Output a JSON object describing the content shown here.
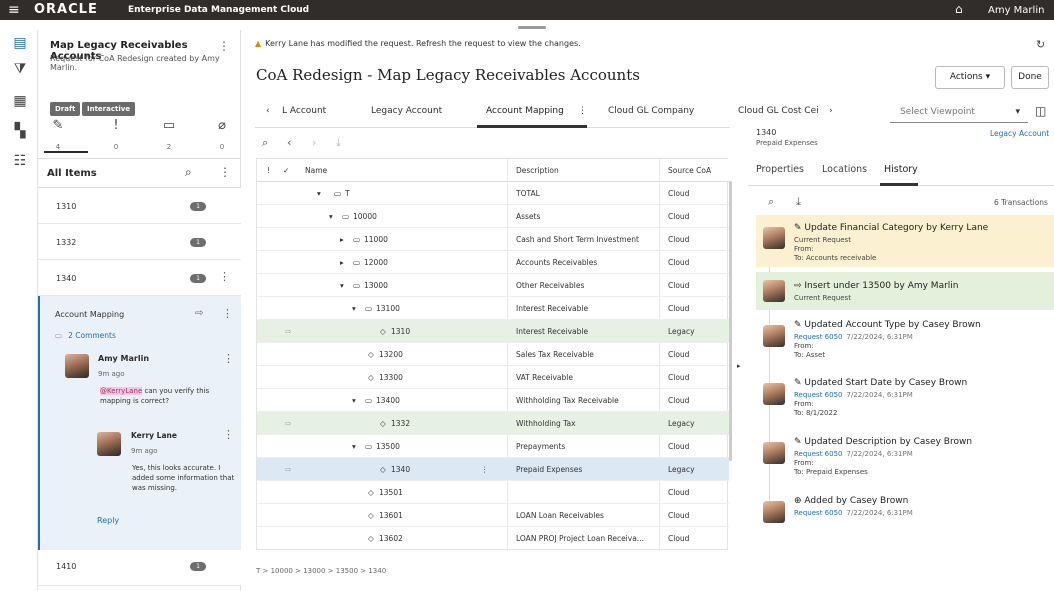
{
  "topbar": {
    "logo": "ORACLE",
    "app_name": "Enterprise Data Management Cloud",
    "user": "Amy Marlin"
  },
  "left_panel": {
    "title": "Map Legacy Receivables Accounts",
    "subtitle": "Request for CoA Redesign created by Amy Marlin.",
    "badges": [
      "Draft",
      "Interactive"
    ],
    "stats": [
      "4",
      "0",
      "2",
      "0"
    ],
    "all_items_label": "All Items",
    "items": [
      {
        "code": "1310",
        "count": "1"
      },
      {
        "code": "1332",
        "count": "1"
      },
      {
        "code": "1340",
        "count": "1"
      },
      {
        "code": "1410",
        "count": "1"
      }
    ],
    "detail": {
      "action": "Account Mapping",
      "comments": "2 Comments",
      "c1_name": "Amy Marlin",
      "c1_time": "9m ago",
      "c1_mention": "@KerryLane",
      "c1_text": " can you verify this mapping is correct?",
      "c2_name": "Kerry Lane",
      "c2_time": "9m ago",
      "c2_text": "Yes, this looks accurate. I added some information that was missing.",
      "reply": "Reply"
    }
  },
  "notice": "Kerry Lane has modified the request. Refresh the request to view the changes.",
  "page_title": "CoA Redesign - Map Legacy Receivables Accounts",
  "buttons": {
    "actions": "Actions",
    "done": "Done"
  },
  "tabs": [
    "L Account",
    "Legacy Account",
    "Account Mapping",
    "Cloud GL Company",
    "Cloud GL Cost Cei"
  ],
  "viewpoint_placeholder": "Select Viewpoint",
  "grid": {
    "headers": {
      "name": "Name",
      "description": "Description",
      "source": "Source CoA"
    },
    "rows": [
      {
        "name": "T",
        "description": "TOTAL",
        "source": "Cloud"
      },
      {
        "name": "10000",
        "description": "Assets",
        "source": "Cloud"
      },
      {
        "name": "11000",
        "description": "Cash and Short Term Investment",
        "source": "Cloud"
      },
      {
        "name": "12000",
        "description": "Accounts Receivables",
        "source": "Cloud"
      },
      {
        "name": "13000",
        "description": "Other Receivables",
        "source": "Cloud"
      },
      {
        "name": "13100",
        "description": "Interest Receivable",
        "source": "Cloud"
      },
      {
        "name": "1310",
        "description": "Interest Receivable",
        "source": "Legacy"
      },
      {
        "name": "13200",
        "description": "Sales Tax Receivable",
        "source": "Cloud"
      },
      {
        "name": "13300",
        "description": "VAT Receivable",
        "source": "Cloud"
      },
      {
        "name": "13400",
        "description": "Withholding Tax Receivable",
        "source": "Cloud"
      },
      {
        "name": "1332",
        "description": "Withholding Tax",
        "source": "Legacy"
      },
      {
        "name": "13500",
        "description": "Prepayments",
        "source": "Cloud"
      },
      {
        "name": "1340",
        "description": "Prepaid Expenses",
        "source": "Legacy"
      },
      {
        "name": "13501",
        "description": "",
        "source": "Cloud"
      },
      {
        "name": "13601",
        "description": "LOAN Loan Receivables",
        "source": "Cloud"
      },
      {
        "name": "13602",
        "description": "LOAN PROJ Project Loan Receiva...",
        "source": "Cloud"
      }
    ]
  },
  "breadcrumb": "T > 10000 > 13000 > 13500 > 1340",
  "right_panel": {
    "code": "1340",
    "desc": "Prepaid Expenses",
    "legacy_link": "Legacy Account",
    "tabs": [
      "Properties",
      "Locations",
      "History"
    ],
    "transactions": "6 Transactions",
    "history": [
      {
        "title": "Update Financial Category by Kerry Lane",
        "l2": "Current Request",
        "l3": "From:",
        "l4": "To:  Accounts receivable"
      },
      {
        "title": "Insert under 13500 by Amy Marlin",
        "l2": "Current Request"
      },
      {
        "title": "Updated Account Type by Casey Brown",
        "req": "Request 6050",
        "date": "7/22/2024, 6:31PM",
        "l3": "From:",
        "l4": "To:  Asset"
      },
      {
        "title": "Updated Start Date by Casey Brown",
        "req": "Request 6050",
        "date": "7/22/2024, 6:31PM",
        "l3": "From:",
        "l4": "To:  8/1/2022"
      },
      {
        "title": "Updated Description by Casey Brown",
        "req": "Request 6050",
        "date": "7/22/2024, 6:31PM",
        "l3": "From:",
        "l4": "To:  Prepaid Expenses"
      },
      {
        "title": "Added by Casey Brown",
        "req": "Request 6050",
        "date": "7/22/2024, 6:31PM"
      }
    ]
  }
}
